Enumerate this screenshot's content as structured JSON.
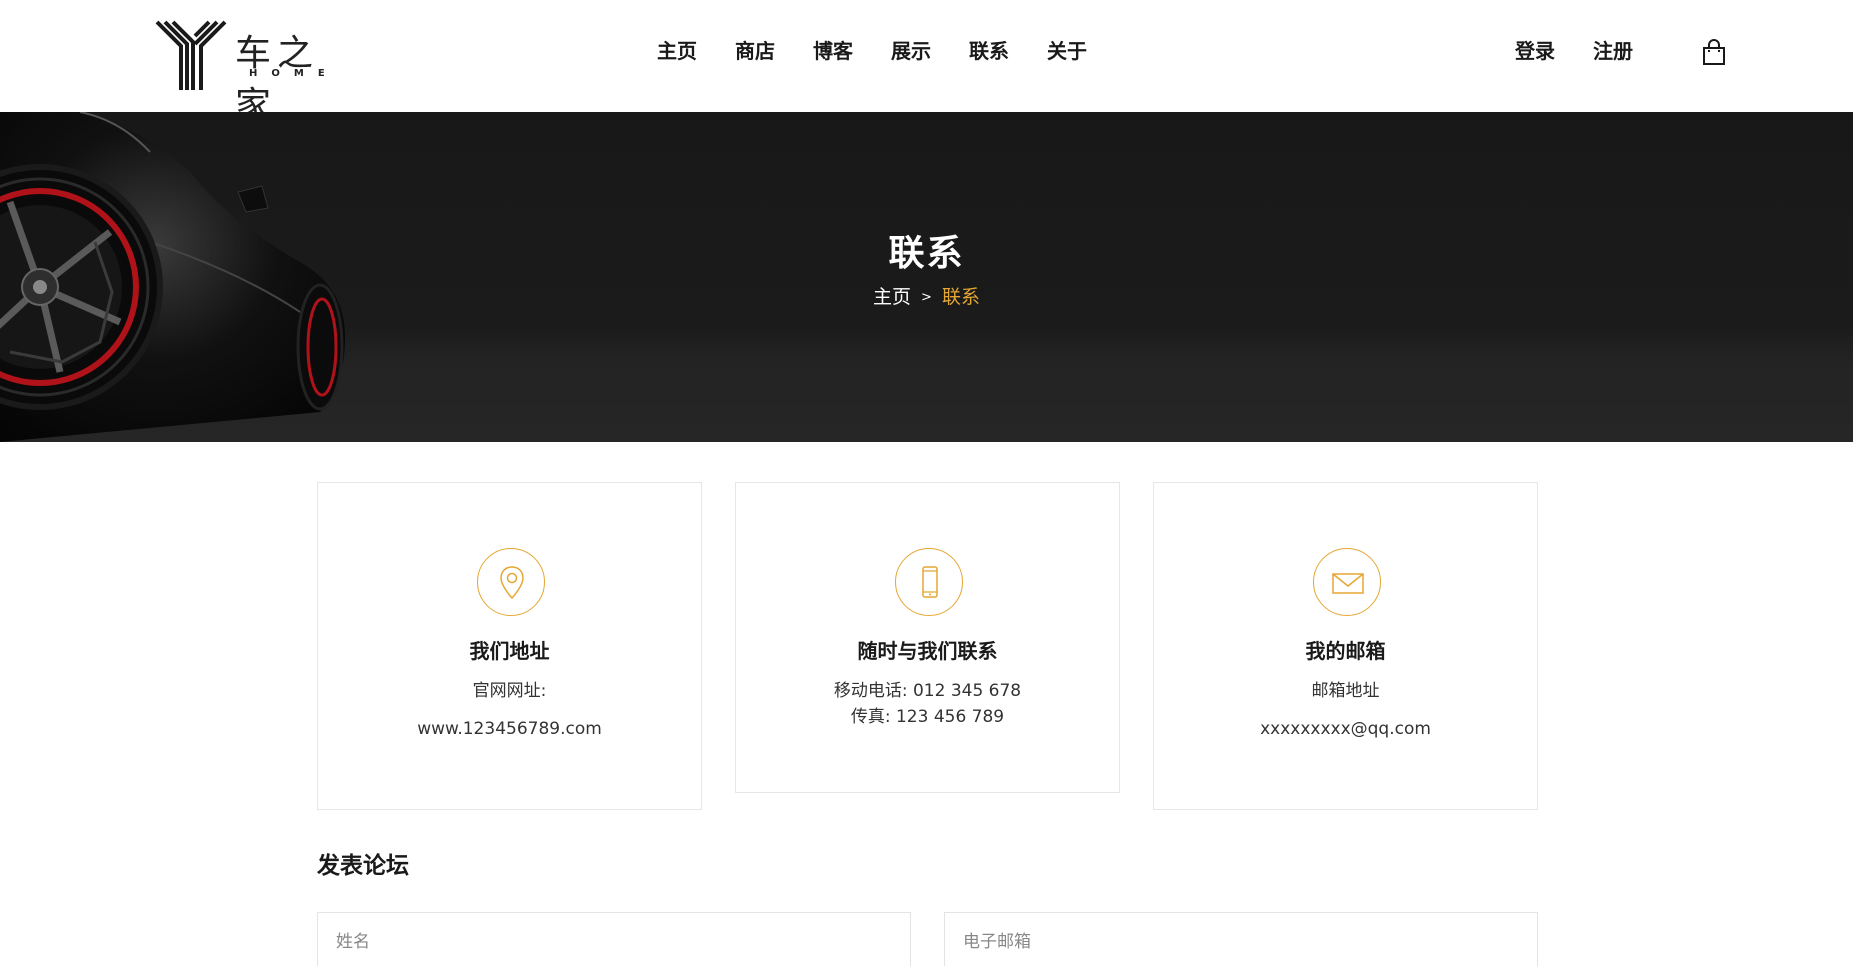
{
  "brand": {
    "name": "车之家",
    "subtitle": "HOME"
  },
  "nav": {
    "items": [
      "主页",
      "商店",
      "博客",
      "展示",
      "联系",
      "关于"
    ]
  },
  "account": {
    "login": "登录",
    "register": "注册",
    "cart_icon": "shopping-bag-icon"
  },
  "banner": {
    "title": "联系",
    "breadcrumb": {
      "home": "主页",
      "separator": ">",
      "current": "联系"
    }
  },
  "cards": [
    {
      "icon": "location-pin-icon",
      "title": "我们地址",
      "lines": [
        "官网网址:",
        "www.123456789.com"
      ]
    },
    {
      "icon": "mobile-phone-icon",
      "title": "随时与我们联系",
      "lines": [
        "移动电话: 012 345 678",
        "传真: 123 456 789"
      ]
    },
    {
      "icon": "envelope-icon",
      "title": "我的邮箱",
      "lines": [
        "邮箱地址",
        "xxxxxxxxx@qq.com"
      ]
    }
  ],
  "form": {
    "title": "发表论坛",
    "name_placeholder": "姓名",
    "email_placeholder": "电子邮箱"
  },
  "colors": {
    "accent": "#e5a633",
    "dark": "#1a1a1a",
    "banner_bg": "#1b1b1b"
  }
}
